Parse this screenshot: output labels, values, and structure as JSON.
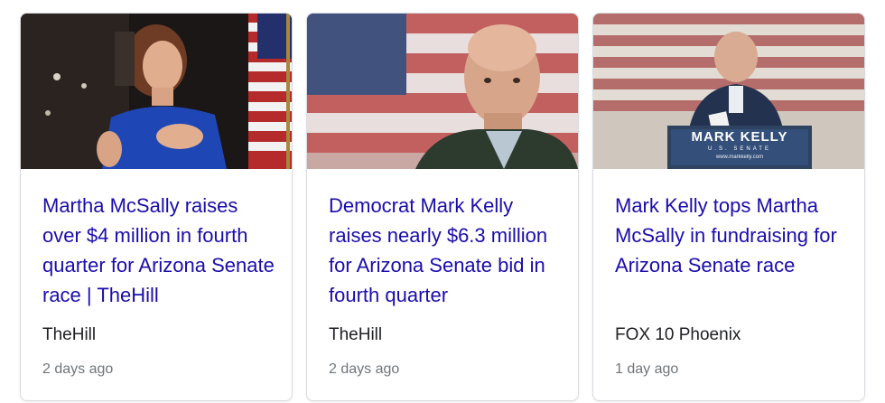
{
  "cards": [
    {
      "title": "Martha McSally raises over $4 million in fourth quarter for Arizona Senate race | TheHill",
      "source": "TheHill",
      "age": "2 days ago",
      "image_alt": "Martha McSally speaking at a podium with an American flag"
    },
    {
      "title": "Democrat Mark Kelly raises nearly $6.3 million for Arizona Senate bid in fourth quarter",
      "source": "TheHill",
      "age": "2 days ago",
      "image_alt": "Mark Kelly in front of an American flag"
    },
    {
      "title": "Mark Kelly tops Martha McSally in fundraising for Arizona Senate race",
      "source": "FOX 10 Phoenix",
      "age": "1 day ago",
      "image_alt": "Mark Kelly speaking at a podium"
    }
  ],
  "podium_sign": {
    "name": "MARK KELLY",
    "office": "U.S. SENATE",
    "url": "www.markkelly.com"
  },
  "colors": {
    "link": "#1a0dab",
    "source_text": "#202124",
    "age_text": "#70757a",
    "card_border": "#dadce0"
  }
}
